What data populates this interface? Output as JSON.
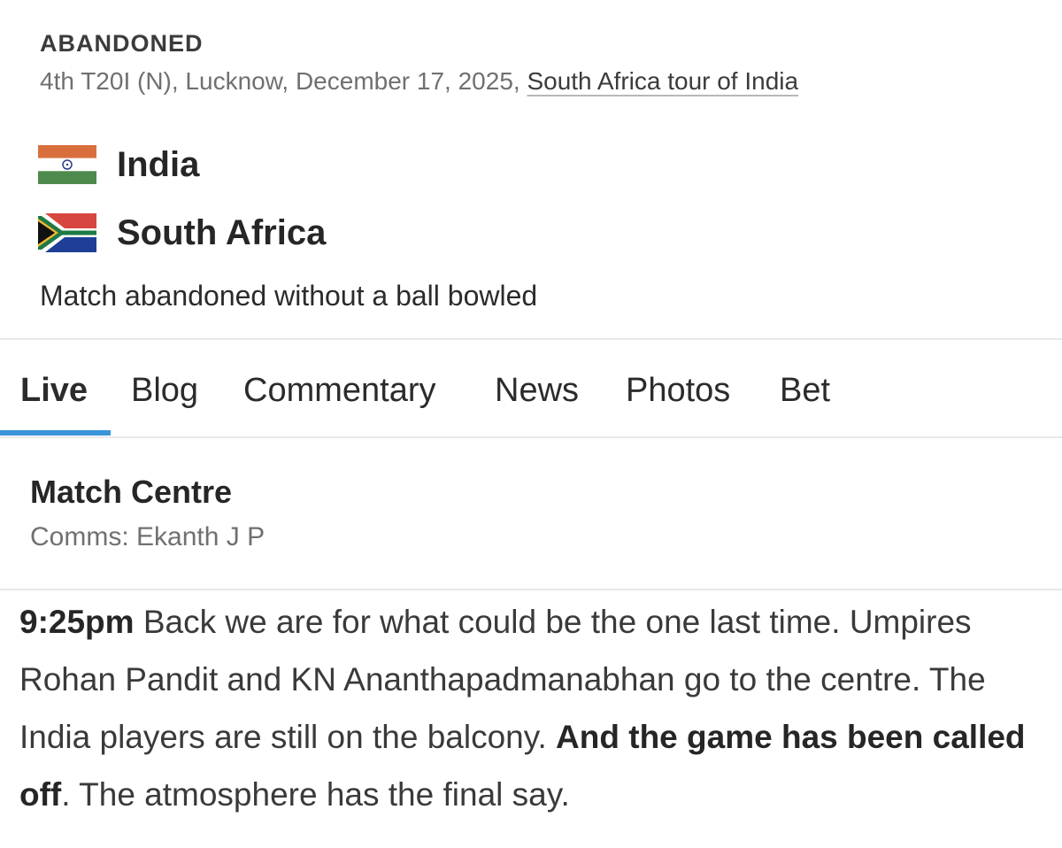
{
  "match": {
    "status": "ABANDONED",
    "meta_prefix": "4th T20I (N), Lucknow, December 17, 2025, ",
    "series_link": "South Africa tour of India",
    "teams": [
      {
        "name": "India",
        "flag": "india-flag-icon"
      },
      {
        "name": "South Africa",
        "flag": "south-africa-flag-icon"
      }
    ],
    "result": "Match abandoned without a ball bowled"
  },
  "tabs": [
    {
      "label": "Live",
      "active": true
    },
    {
      "label": "Blog",
      "active": false
    },
    {
      "label": "Commentary",
      "active": false
    },
    {
      "label": "News",
      "active": false
    },
    {
      "label": "Photos",
      "active": false
    },
    {
      "label": "Bet",
      "active": false
    }
  ],
  "match_centre": {
    "title": "Match Centre",
    "comms": "Comms: Ekanth J P"
  },
  "commentary": {
    "time": "9:25pm",
    "text_1": " Back we are for what could be the one last time. Umpires Rohan Pandit and KN Ananthapadmanabhan go to the centre. The India players are still on the balcony. ",
    "highlight": "And the game has been called off",
    "text_2": ". The atmosphere has the final say."
  },
  "colors": {
    "accent": "#3a94d8",
    "divider": "#e6e8ec",
    "india_saffron": "#d86f3c",
    "india_green": "#4e8a4c",
    "sa_red": "#d8473f",
    "sa_blue": "#1e3f95",
    "sa_green": "#1e7a44"
  }
}
